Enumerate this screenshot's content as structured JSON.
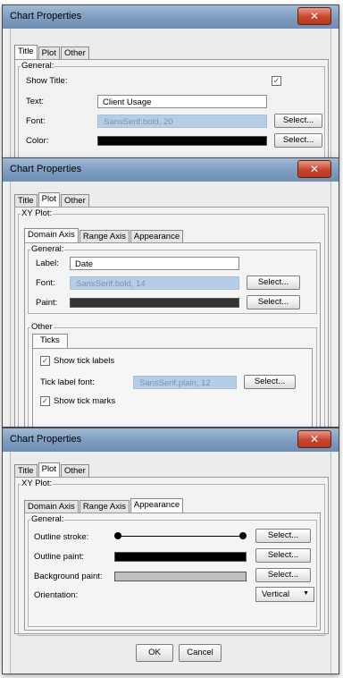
{
  "dialogs": {
    "title": "Chart Properties",
    "close": "✕",
    "main_tabs": [
      "Title",
      "Plot",
      "Other"
    ],
    "axis_tabs": [
      "Domain Axis",
      "Range Axis",
      "Appearance"
    ],
    "xy_plot_label": "XY Plot:",
    "general_label": "General:",
    "select_label": "Select..."
  },
  "title_tab": {
    "show_title_label": "Show Title:",
    "show_title_checked": true,
    "text_label": "Text:",
    "text_value": "Client Usage",
    "font_label": "Font:",
    "font_value": "SansSerif.bold, 20",
    "color_label": "Color:",
    "color_swatch": "#000000"
  },
  "domain_axis": {
    "label_label": "Label:",
    "label_value": "Date",
    "font_label": "Font:",
    "font_value": "SansSerif.bold, 14",
    "paint_label": "Paint:",
    "paint_swatch": "#333333",
    "other_label": "Other",
    "ticks_tab": "Ticks",
    "show_tick_labels": "Show tick labels",
    "show_tick_labels_checked": true,
    "tick_label_font_label": "Tick label font:",
    "tick_label_font_value": "SansSerif.plain, 12",
    "show_tick_marks": "Show tick marks",
    "show_tick_marks_checked": true
  },
  "appearance": {
    "outline_stroke_label": "Outline stroke:",
    "outline_paint_label": "Outline paint:",
    "outline_paint_swatch": "#000000",
    "background_paint_label": "Background paint:",
    "background_paint_swatch": "#c0c0c0",
    "orientation_label": "Orientation:",
    "orientation_value": "Vertical",
    "ok_label": "OK",
    "cancel_label": "Cancel"
  }
}
